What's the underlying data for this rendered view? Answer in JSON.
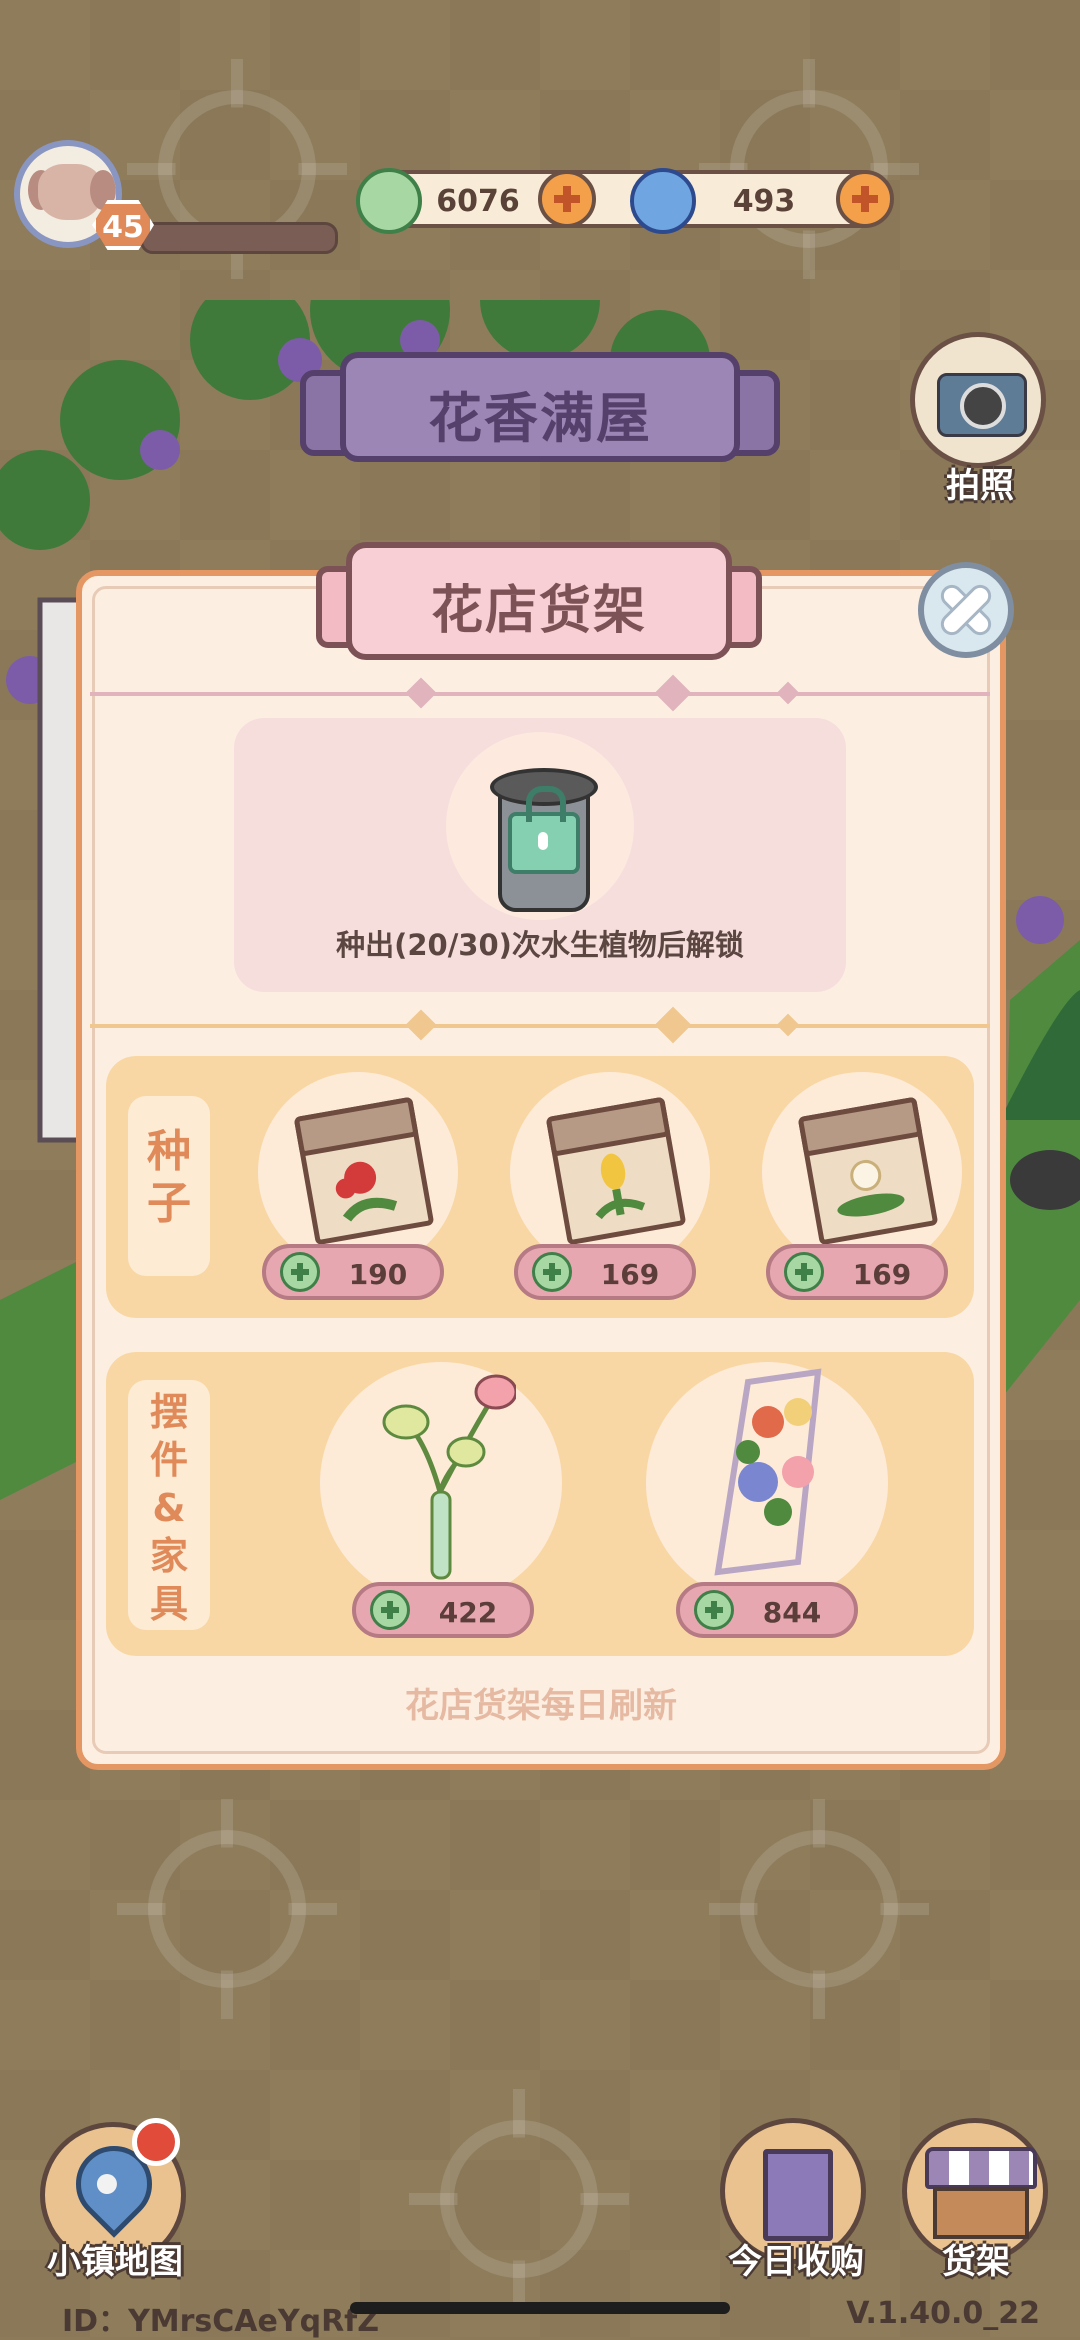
{
  "top_bar": {
    "player_level": "45",
    "clover_currency": "6076",
    "gem_currency": "493"
  },
  "camera": {
    "label": "拍照"
  },
  "house_banner": {
    "title": "花香满屋"
  },
  "shop_panel": {
    "title": "花店货架",
    "locked_slot": {
      "unlock_requirement": "种出(20/30)次水生植物后解锁"
    },
    "sections": {
      "seeds": {
        "label": "种子",
        "items": [
          {
            "name": "red-flower-seed",
            "price": "190"
          },
          {
            "name": "yellow-tulip-seed",
            "price": "169"
          },
          {
            "name": "water-lily-seed",
            "price": "169"
          }
        ]
      },
      "decor": {
        "label": "摆件&家具",
        "items": [
          {
            "name": "anthurium-vase",
            "price": "422"
          },
          {
            "name": "flower-shelf",
            "price": "844"
          }
        ]
      }
    },
    "footer_note": "花店货架每日刷新"
  },
  "bottom_nav": {
    "town_map": "小镇地图",
    "daily_purchase": "今日收购",
    "shelf": "货架"
  },
  "footer": {
    "user_id": "ID：YMrsCAeYqRfZ",
    "version": "V.1.40.0_22"
  },
  "colors": {
    "panel_border": "#e49763",
    "section_bg": "#f8d7a4",
    "price_tag": "#e6a7b0",
    "accent_text": "#e08a5a"
  }
}
